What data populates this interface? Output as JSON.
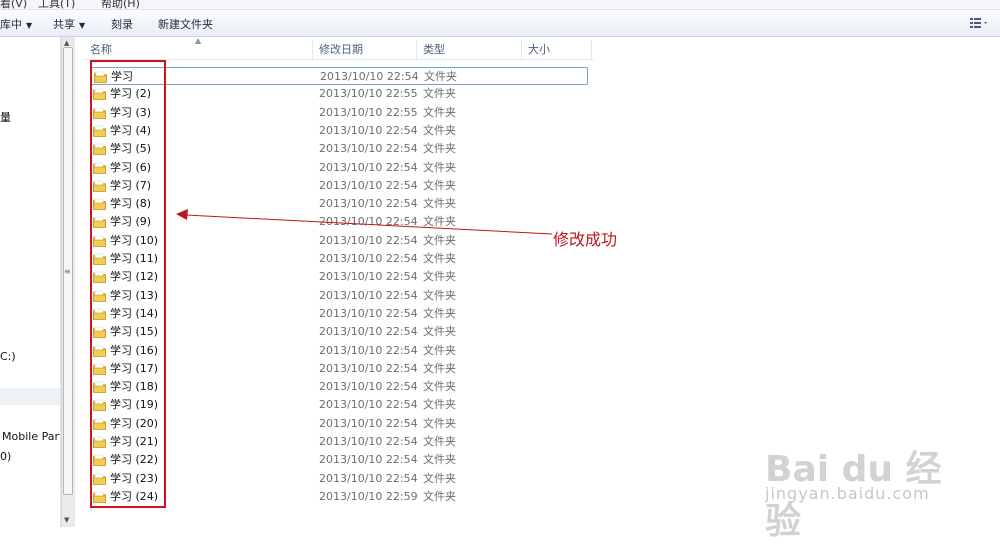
{
  "menubar": {
    "items": [
      "看(V)",
      "工具(T)",
      "帮助(H)"
    ]
  },
  "toolbar": {
    "organize_label": "库中",
    "share_label": "共享",
    "burn_label": "刻录",
    "new_folder_label": "新建文件夹"
  },
  "nav": {
    "items": [
      "量",
      "C:)",
      "Mobile Part",
      "0)"
    ]
  },
  "columns": {
    "name": "名称",
    "date": "修改日期",
    "type": "类型",
    "size": "大小"
  },
  "files": [
    {
      "name": "学习",
      "date": "2013/10/10 22:54",
      "type": "文件夹"
    },
    {
      "name": "学习 (2)",
      "date": "2013/10/10 22:55",
      "type": "文件夹"
    },
    {
      "name": "学习 (3)",
      "date": "2013/10/10 22:55",
      "type": "文件夹"
    },
    {
      "name": "学习 (4)",
      "date": "2013/10/10 22:54",
      "type": "文件夹"
    },
    {
      "name": "学习 (5)",
      "date": "2013/10/10 22:54",
      "type": "文件夹"
    },
    {
      "name": "学习 (6)",
      "date": "2013/10/10 22:54",
      "type": "文件夹"
    },
    {
      "name": "学习 (7)",
      "date": "2013/10/10 22:54",
      "type": "文件夹"
    },
    {
      "name": "学习 (8)",
      "date": "2013/10/10 22:54",
      "type": "文件夹"
    },
    {
      "name": "学习 (9)",
      "date": "2013/10/10 22:54",
      "type": "文件夹"
    },
    {
      "name": "学习 (10)",
      "date": "2013/10/10 22:54",
      "type": "文件夹"
    },
    {
      "name": "学习 (11)",
      "date": "2013/10/10 22:54",
      "type": "文件夹"
    },
    {
      "name": "学习 (12)",
      "date": "2013/10/10 22:54",
      "type": "文件夹"
    },
    {
      "name": "学习 (13)",
      "date": "2013/10/10 22:54",
      "type": "文件夹"
    },
    {
      "name": "学习 (14)",
      "date": "2013/10/10 22:54",
      "type": "文件夹"
    },
    {
      "name": "学习 (15)",
      "date": "2013/10/10 22:54",
      "type": "文件夹"
    },
    {
      "name": "学习 (16)",
      "date": "2013/10/10 22:54",
      "type": "文件夹"
    },
    {
      "name": "学习 (17)",
      "date": "2013/10/10 22:54",
      "type": "文件夹"
    },
    {
      "name": "学习 (18)",
      "date": "2013/10/10 22:54",
      "type": "文件夹"
    },
    {
      "name": "学习 (19)",
      "date": "2013/10/10 22:54",
      "type": "文件夹"
    },
    {
      "name": "学习 (20)",
      "date": "2013/10/10 22:54",
      "type": "文件夹"
    },
    {
      "name": "学习 (21)",
      "date": "2013/10/10 22:54",
      "type": "文件夹"
    },
    {
      "name": "学习 (22)",
      "date": "2013/10/10 22:54",
      "type": "文件夹"
    },
    {
      "name": "学习 (23)",
      "date": "2013/10/10 22:54",
      "type": "文件夹"
    },
    {
      "name": "学习 (24)",
      "date": "2013/10/10 22:59",
      "type": "文件夹"
    }
  ],
  "annotation": {
    "text": "修改成功",
    "color": "#c0151d"
  },
  "watermark": {
    "logo": "Bai du 经验",
    "url": "jingyan.baidu.com"
  }
}
